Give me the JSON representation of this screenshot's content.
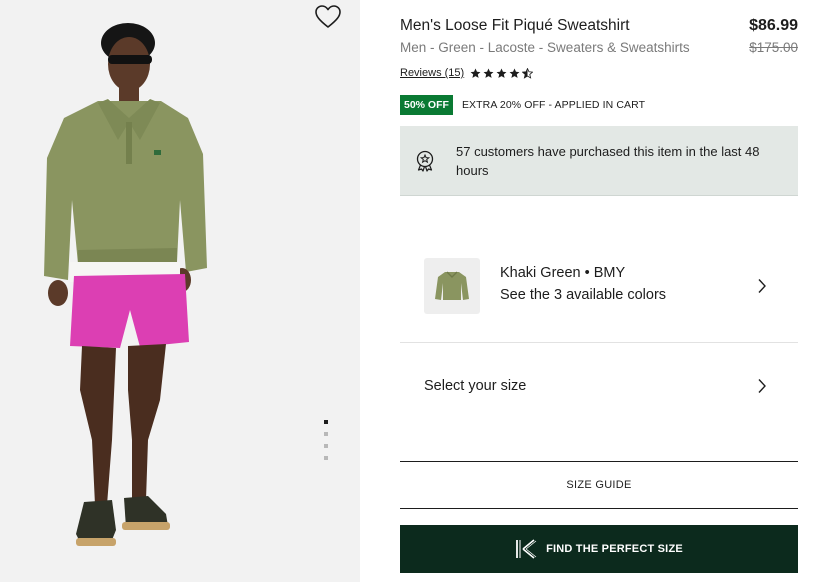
{
  "product": {
    "title": "Men's Loose Fit Piqué Sweatshirt",
    "subtitle": "Men - Green - Lacoste - Sweaters & Sweatshirts",
    "price": "$86.99",
    "original_price": "$175.00",
    "reviews_label": "Reviews (15)",
    "rating": 4.5,
    "rating_max": 5
  },
  "promo": {
    "badge": "50% OFF",
    "text": "EXTRA 20% OFF - APPLIED IN CART"
  },
  "notice": {
    "icon": "medal-icon",
    "text": "57 customers have purchased this item in the last 48 hours"
  },
  "color": {
    "name": "Khaki Green • BMY",
    "link": "See the 3 available colors"
  },
  "size": {
    "label": "Select your size"
  },
  "buttons": {
    "size_guide": "SIZE GUIDE",
    "find_size": "FIND THE PERFECT SIZE"
  },
  "gallery": {
    "total_images": 4,
    "active_index": 0
  },
  "colors": {
    "sale_badge": "#0a7a33",
    "cta": "#0c2a1d",
    "notice_bg": "#e3e8e5"
  }
}
